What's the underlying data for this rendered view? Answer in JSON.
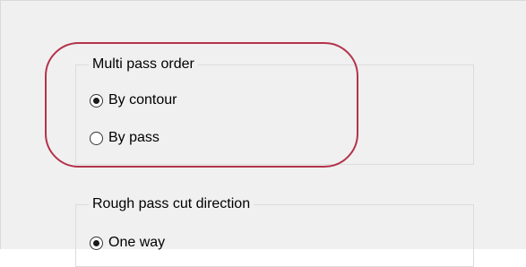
{
  "multi_pass_order": {
    "title": "Multi pass order",
    "options": [
      {
        "label": "By contour",
        "selected": true
      },
      {
        "label": "By pass",
        "selected": false
      }
    ]
  },
  "rough_pass_cut_direction": {
    "title": "Rough pass cut direction",
    "options": [
      {
        "label": "One way",
        "selected": true
      }
    ]
  },
  "highlight": {
    "color": "#b3334a",
    "target": "Multi pass order"
  }
}
